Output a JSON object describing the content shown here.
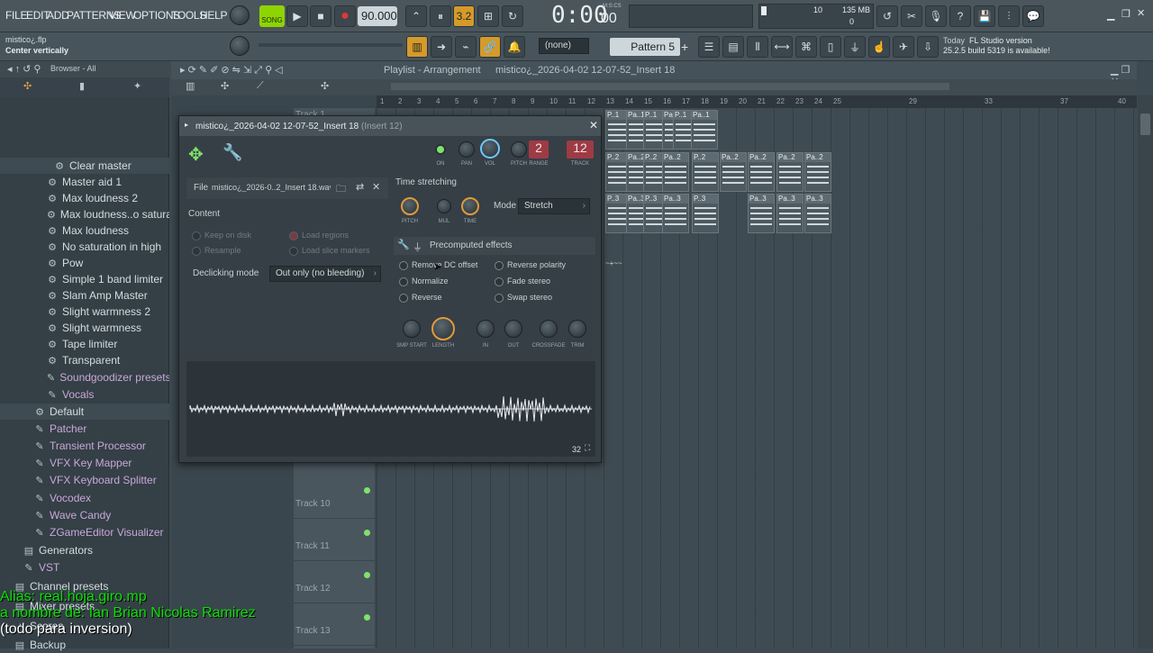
{
  "menu": [
    "FILE",
    "EDIT",
    "ADD",
    "PATTERNS",
    "VIEW",
    "OPTIONS",
    "TOOLS",
    "HELP"
  ],
  "transport": {
    "mode": "SONG",
    "tempo": "90.000",
    "time": "0:00",
    "time_unit": "00",
    "mscs": "M:S:CS",
    "cpu": "10",
    "mem": "135 MB",
    "mem2": "0"
  },
  "hint": {
    "file": "mistico¿.flp",
    "text": "Center vertically"
  },
  "secondbar": {
    "none": "(none)",
    "pattern": "Pattern 5",
    "news_date": "Today",
    "news_title": "FL Studio version",
    "news_text": "25.2.5 build 5319 is available!"
  },
  "browser": {
    "title": "Browser - All",
    "items": [
      {
        "label": "Clear master",
        "icon": "gear-icon"
      },
      {
        "label": "Master aid 1",
        "icon": "gear-icon"
      },
      {
        "label": "Max loudness 2",
        "icon": "gear-icon"
      },
      {
        "label": "Max loudness..o saturation",
        "icon": "gear-icon"
      },
      {
        "label": "Max loudness",
        "icon": "gear-icon"
      },
      {
        "label": "No saturation in high",
        "icon": "gear-icon"
      },
      {
        "label": "Pow",
        "icon": "gear-icon"
      },
      {
        "label": "Simple 1 band limiter",
        "icon": "gear-icon"
      },
      {
        "label": "Slam Amp Master",
        "icon": "gear-icon"
      },
      {
        "label": "Slight warmness 2",
        "icon": "gear-icon"
      },
      {
        "label": "Slight warmness",
        "icon": "gear-icon"
      },
      {
        "label": "Tape limiter",
        "icon": "gear-icon"
      },
      {
        "label": "Transparent",
        "icon": "gear-icon"
      },
      {
        "label": "Soundgoodizer presets",
        "icon": "plugin-icon"
      },
      {
        "label": "Vocals",
        "icon": "plugin-icon"
      },
      {
        "label": "Default",
        "icon": "gear-icon"
      },
      {
        "label": "Patcher",
        "icon": "plugin-icon"
      },
      {
        "label": "Transient Processor",
        "icon": "plugin-icon"
      },
      {
        "label": "VFX Key Mapper",
        "icon": "plugin-icon"
      },
      {
        "label": "VFX Keyboard Splitter",
        "icon": "plugin-icon"
      },
      {
        "label": "Vocodex",
        "icon": "plugin-icon"
      },
      {
        "label": "Wave Candy",
        "icon": "plugin-icon"
      },
      {
        "label": "ZGameEditor Visualizer",
        "icon": "plugin-icon"
      },
      {
        "label": "Generators",
        "icon": "folder-icon"
      },
      {
        "label": "VST",
        "icon": "plugin-icon"
      },
      {
        "label": "Channel presets",
        "icon": "folder-icon"
      },
      {
        "label": "Mixer presets",
        "icon": "folder-icon"
      },
      {
        "label": "Scores",
        "icon": "note-icon"
      },
      {
        "label": "Backup",
        "icon": "folder-icon"
      }
    ]
  },
  "playlist": {
    "title": "Playlist - Arrangement",
    "crumb": "mistico¿_2026-04-02 12-07-52_Insert 18",
    "ruler": [
      "1",
      "2",
      "3",
      "4",
      "5",
      "6",
      "7",
      "8",
      "9",
      "10",
      "11",
      "12",
      "13",
      "14",
      "15",
      "16",
      "17",
      "18",
      "19",
      "20",
      "21",
      "22",
      "23",
      "24",
      "25",
      "29",
      "33",
      "37",
      "40"
    ],
    "tracks": [
      "Track 1",
      "Track 10",
      "Track 11",
      "Track 12",
      "Track 13"
    ],
    "clips_row1": [
      "P..1",
      "Pa..1",
      "P..1",
      "Pa..1",
      "P..1",
      "Pa..1"
    ],
    "clips_row2": [
      "P..2",
      "Pa..2",
      "P..2",
      "Pa..2",
      "P..2",
      "Pa..2",
      "Pa..2",
      "Pa..2",
      "Pa..2"
    ],
    "clips_row3": [
      "P..3",
      "Pa..3",
      "P..3",
      "Pa..3",
      "P..3",
      "Pa..3",
      "Pa..3",
      "Pa..3"
    ]
  },
  "sampler": {
    "title": "mistico¿_2026-04-02 12-07-52_Insert 18",
    "title_suffix": "(Insert 12)",
    "knobs": [
      "ON",
      "PAN",
      "VOL",
      "PITCH",
      "RANGE",
      "TRACK"
    ],
    "range": "2",
    "track": "12",
    "file_label": "File",
    "file_name": "mistico¿_2026-0..2_Insert 18.wav",
    "content": "Content",
    "keep_on_disk": "Keep on disk",
    "load_regions": "Load regions",
    "resample": "Resample",
    "load_slice": "Load slice markers",
    "declick_label": "Declicking mode",
    "declick_value": "Out only (no bleeding)",
    "ts_title": "Time stretching",
    "ts_knobs": [
      "PITCH",
      "MUL",
      "TIME"
    ],
    "mode_label": "Mode",
    "mode_value": "Stretch",
    "pre_title": "Precomputed effects",
    "effects_left": [
      "Remove DC offset",
      "Normalize",
      "Reverse"
    ],
    "effects_right": [
      "Reverse polarity",
      "Fade stereo",
      "Swap stereo"
    ],
    "bottom_knobs": [
      "SMP START",
      "LENGTH",
      "IN",
      "OUT",
      "CROSSFADE",
      "TRIM"
    ],
    "zoom": "32"
  },
  "overlay": {
    "line1": "Alias: real.hoja.giro.mp",
    "line2": "a nombre de: Ian Brian Nicolas Ramirez",
    "line3": "(todo para inversion)"
  }
}
